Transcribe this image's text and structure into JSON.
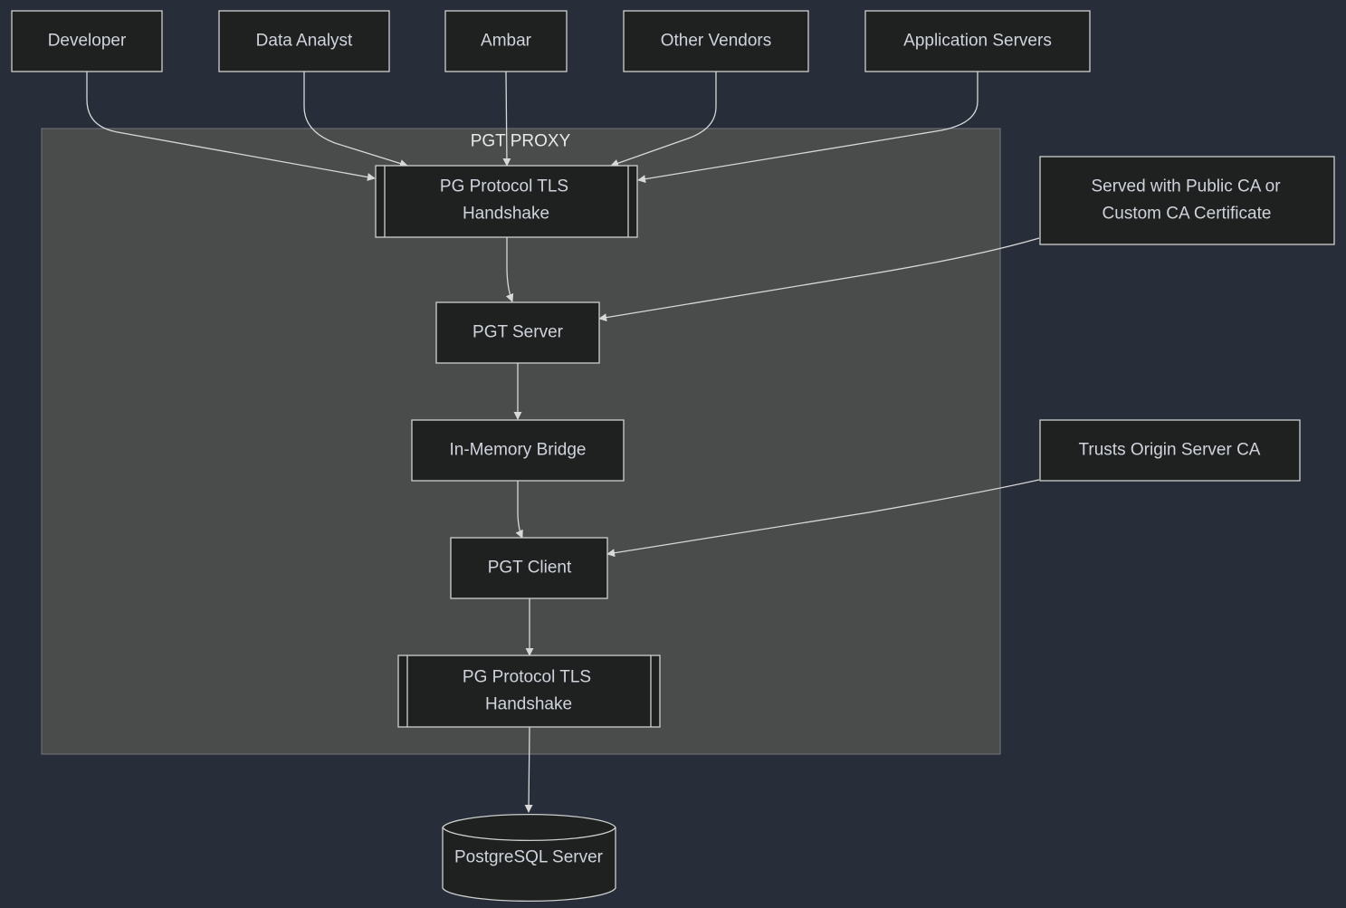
{
  "diagram": {
    "type": "flowchart",
    "cluster": {
      "id": "pgt_proxy",
      "label": "PGT PROXY"
    },
    "nodes": [
      {
        "id": "developer",
        "label": "Developer",
        "shape": "rect"
      },
      {
        "id": "data_analyst",
        "label": "Data Analyst",
        "shape": "rect"
      },
      {
        "id": "ambar",
        "label": "Ambar",
        "shape": "rect"
      },
      {
        "id": "other_vendors",
        "label": "Other Vendors",
        "shape": "rect"
      },
      {
        "id": "app_servers",
        "label": "Application Servers",
        "shape": "rect"
      },
      {
        "id": "tls_in",
        "label_lines": [
          "PG Protocol TLS",
          "Handshake"
        ],
        "shape": "subroutine"
      },
      {
        "id": "public_ca",
        "label_lines": [
          "Served with Public CA or",
          "Custom CA Certificate"
        ],
        "shape": "rect"
      },
      {
        "id": "pgt_server",
        "label": "PGT Server",
        "shape": "rect"
      },
      {
        "id": "bridge",
        "label": "In-Memory Bridge",
        "shape": "rect"
      },
      {
        "id": "trusts_ca",
        "label": "Trusts Origin Server CA",
        "shape": "rect"
      },
      {
        "id": "pgt_client",
        "label": "PGT Client",
        "shape": "rect"
      },
      {
        "id": "tls_out",
        "label_lines": [
          "PG Protocol TLS",
          "Handshake"
        ],
        "shape": "subroutine"
      },
      {
        "id": "postgres",
        "label": "PostgreSQL Server",
        "shape": "cylinder"
      }
    ],
    "edges": [
      {
        "from": "developer",
        "to": "tls_in"
      },
      {
        "from": "data_analyst",
        "to": "tls_in"
      },
      {
        "from": "ambar",
        "to": "tls_in"
      },
      {
        "from": "other_vendors",
        "to": "tls_in"
      },
      {
        "from": "app_servers",
        "to": "tls_in"
      },
      {
        "from": "tls_in",
        "to": "pgt_server"
      },
      {
        "from": "public_ca",
        "to": "pgt_server"
      },
      {
        "from": "pgt_server",
        "to": "bridge"
      },
      {
        "from": "bridge",
        "to": "pgt_client"
      },
      {
        "from": "trusts_ca",
        "to": "pgt_client"
      },
      {
        "from": "pgt_client",
        "to": "tls_out"
      },
      {
        "from": "tls_out",
        "to": "postgres"
      }
    ]
  }
}
